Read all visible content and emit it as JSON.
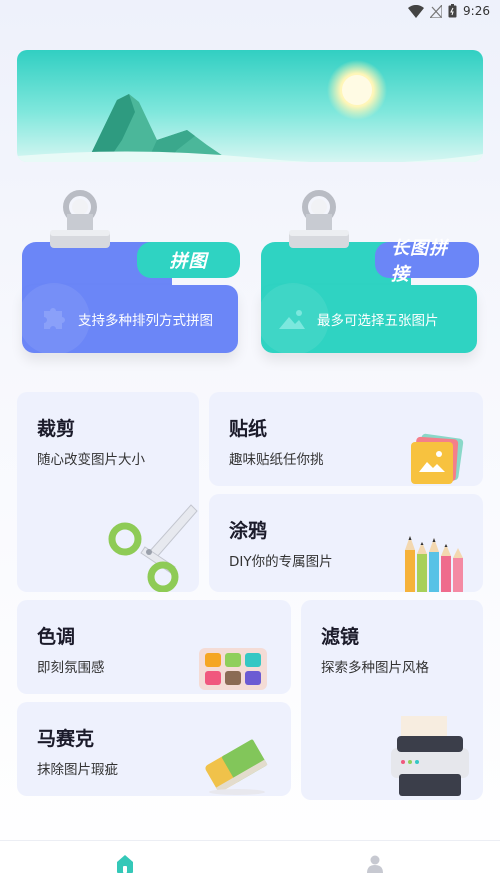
{
  "status_bar": {
    "time": "9:26",
    "icons": [
      "wifi-icon",
      "no-signal-icon",
      "battery-icon"
    ]
  },
  "banner": {
    "image": "mountain-landscape-illustration"
  },
  "features": {
    "collage": {
      "tab_label": "拼图",
      "description": "支持多种排列方式拼图",
      "icon": "puzzle-icon",
      "color": "#6b86f7"
    },
    "long_image": {
      "tab_label": "长图拼接",
      "description": "最多可选择五张图片",
      "icon": "image-icon",
      "color": "#2fd3c2"
    }
  },
  "tools": {
    "crop": {
      "title": "裁剪",
      "subtitle": "随心改变图片大小",
      "icon": "scissors-icon"
    },
    "sticker": {
      "title": "贴纸",
      "subtitle": "趣味贴纸任你挑",
      "icon": "sticker-icon"
    },
    "doodle": {
      "title": "涂鸦",
      "subtitle": "DIY你的专属图片",
      "icon": "pencils-icon"
    },
    "tone": {
      "title": "色调",
      "subtitle": "即刻氛围感",
      "icon": "palette-icon"
    },
    "filter": {
      "title": "滤镜",
      "subtitle": "探索多种图片风格",
      "icon": "printer-icon"
    },
    "mosaic": {
      "title": "马赛克",
      "subtitle": "抹除图片瑕疵",
      "icon": "eraser-icon"
    }
  },
  "bottom_nav": {
    "items": [
      {
        "name": "home",
        "icon": "home-icon",
        "active": true,
        "color": "#34c8b8"
      },
      {
        "name": "profile",
        "icon": "profile-icon",
        "active": false,
        "color": "#c7c9d1"
      }
    ]
  }
}
